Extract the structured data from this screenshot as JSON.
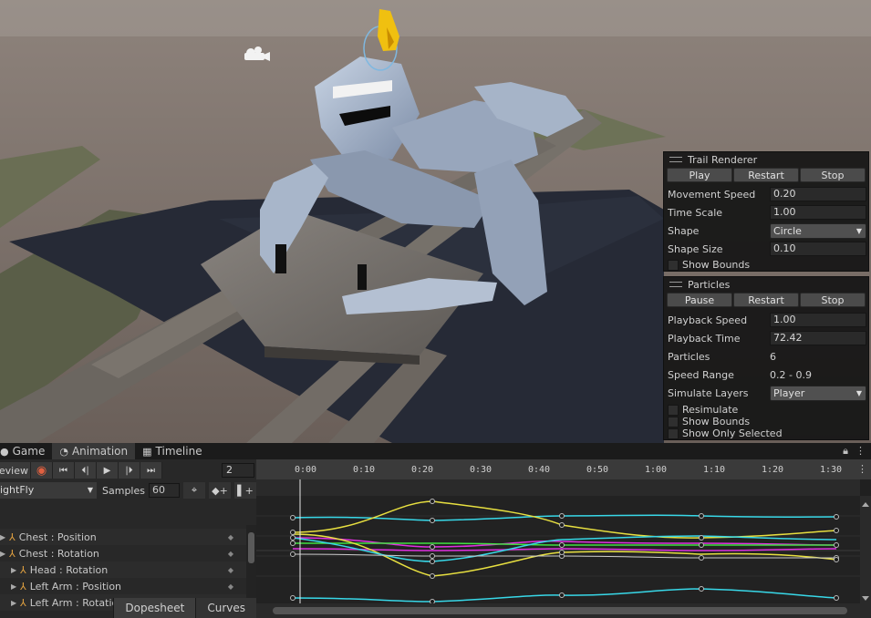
{
  "trail_renderer": {
    "title": "Trail Renderer",
    "buttons": [
      "Play",
      "Restart",
      "Stop"
    ],
    "movement_speed_label": "Movement Speed",
    "movement_speed": "0.20",
    "time_scale_label": "Time Scale",
    "time_scale": "1.00",
    "shape_label": "Shape",
    "shape": "Circle",
    "shape_size_label": "Shape Size",
    "shape_size": "0.10",
    "show_bounds": "Show Bounds"
  },
  "particles": {
    "title": "Particles",
    "buttons": [
      "Pause",
      "Restart",
      "Stop"
    ],
    "playback_speed_label": "Playback Speed",
    "playback_speed": "1.00",
    "playback_time_label": "Playback Time",
    "playback_time": "72.42",
    "particles_label": "Particles",
    "particles_count": "6",
    "speed_range_label": "Speed Range",
    "speed_range": "0.2 - 0.9",
    "simulate_layers_label": "Simulate Layers",
    "simulate_layers": "Player",
    "checkboxes": [
      "Resimulate",
      "Show Bounds",
      "Show Only Selected"
    ]
  },
  "tabs": {
    "game": "Game",
    "animation": "Animation",
    "timeline": "Timeline"
  },
  "controls": {
    "preview": "eview",
    "frame": "2",
    "clip": "ightFly",
    "samples_label": "Samples",
    "samples": "60"
  },
  "properties": [
    {
      "label": "Chest : Position"
    },
    {
      "label": "Chest : Rotation"
    },
    {
      "label": "Head : Rotation"
    },
    {
      "label": "Left Arm : Position"
    },
    {
      "label": "Left Arm : Rotation"
    }
  ],
  "bottom_tabs": {
    "dopesheet": "Dopesheet",
    "curves": "Curves"
  },
  "ruler_ticks": [
    "0:00",
    "0:10",
    "0:20",
    "0:30",
    "0:40",
    "0:50",
    "1:00",
    "1:10",
    "1:20",
    "1:30"
  ],
  "colors": {
    "curve_cyan": "#38d8e8",
    "curve_yellow": "#e8e040",
    "curve_magenta": "#e030e0",
    "curve_green": "#40e040",
    "panel_bg": "#161616"
  }
}
